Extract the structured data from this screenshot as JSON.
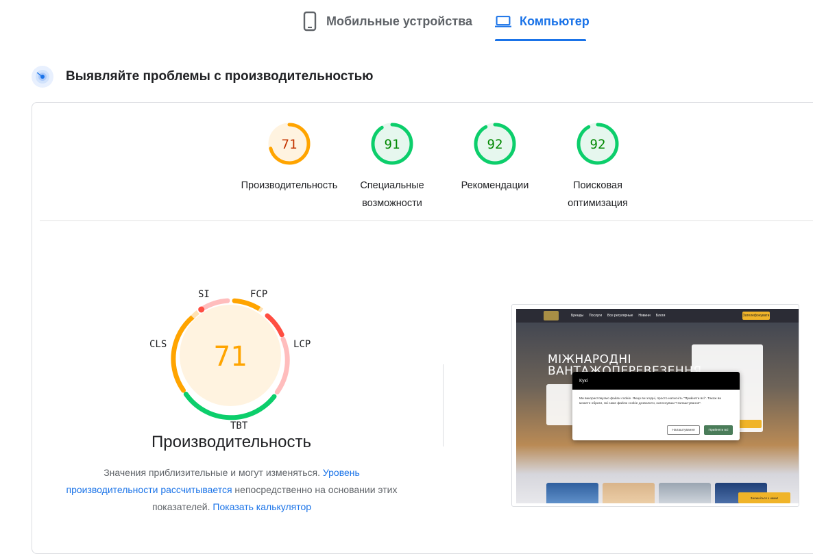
{
  "tabs": [
    {
      "label": "Мобильные устройства",
      "icon": "phone-icon",
      "active": false
    },
    {
      "label": "Компьютер",
      "icon": "laptop-icon",
      "active": true
    }
  ],
  "section": {
    "title": "Выявляйте проблемы с производительностью",
    "icon": "radar-icon"
  },
  "colors": {
    "orange": "#ffa400",
    "orange_text": "#c33300",
    "orange_bg": "#fff3e0",
    "green": "#0cce6b",
    "green_text": "#008800",
    "green_bg": "#e6f7ee",
    "red": "#ff4e42",
    "accent": "#1a73e8"
  },
  "scores": [
    {
      "value": "71",
      "label_lines": [
        "Производительность"
      ],
      "status": "average",
      "fraction": 0.71
    },
    {
      "value": "91",
      "label_lines": [
        "Специальные",
        "возможности"
      ],
      "status": "pass",
      "fraction": 0.91
    },
    {
      "value": "92",
      "label_lines": [
        "Рекомендации"
      ],
      "status": "pass",
      "fraction": 0.92
    },
    {
      "value": "92",
      "label_lines": [
        "Поисковая",
        "оптимизация"
      ],
      "status": "pass",
      "fraction": 0.92
    }
  ],
  "performance": {
    "score": "71",
    "title": "Производительность",
    "metrics": [
      "SI",
      "FCP",
      "LCP",
      "TBT",
      "CLS"
    ],
    "description_part1": "Значения приблизительные и могут изменяться. ",
    "link1": "Уровень производительности рассчитывается",
    "description_part2": " непосредственно на основании этих показателей. ",
    "link2": "Показать калькулятор"
  },
  "thumbnail": {
    "nav_items": [
      "Бренды",
      "Послуги",
      "Все регулярные",
      "Новини",
      "Блоги"
    ],
    "cta": "Зателефонувати",
    "hero_title_line1": "МІЖНАРОДНІ",
    "hero_title_line2": "ВАНТАЖОПЕРЕВЕЗЕННЯ",
    "modal_title": "Кукі",
    "modal_text": "Ми використовуємо файли cookie. Якщо ви згодні, просто натисніть \"Прийняти всі\". Також ви можете обрати, які саме файли cookie дозволити, натиснувши \"Налаштування\".",
    "modal_settings": "Налаштування",
    "modal_accept": "Прийняти всі",
    "chat": "Залишіться з нами!"
  }
}
